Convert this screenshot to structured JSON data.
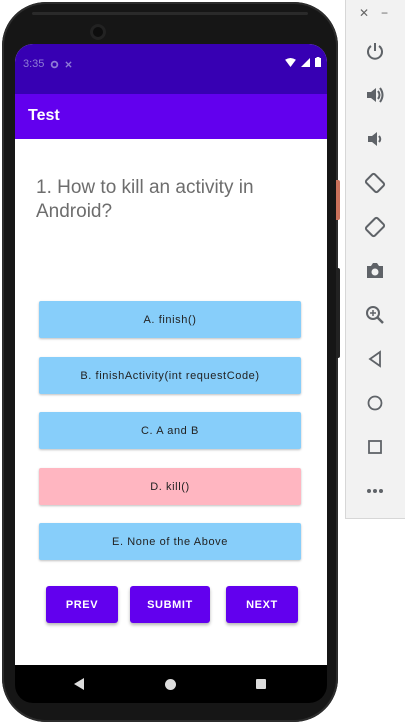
{
  "status_bar": {
    "time": "3:35"
  },
  "app_bar": {
    "title": "Test"
  },
  "question": {
    "text": "1. How to kill an activity in Android?"
  },
  "options": [
    {
      "label": "A. finish()",
      "state": "default"
    },
    {
      "label": "B. finishActivity(int requestCode)",
      "state": "default"
    },
    {
      "label": "C. A and B",
      "state": "default"
    },
    {
      "label": "D. kill()",
      "state": "selected-wrong"
    },
    {
      "label": "E. None of the Above",
      "state": "default"
    }
  ],
  "navigation": {
    "prev_label": "PREV",
    "submit_label": "SUBMIT",
    "next_label": "NEXT"
  },
  "colors": {
    "status_bar": "#3700b3",
    "app_bar": "#6200ee",
    "option_default": "#87cefa",
    "option_wrong": "#ffb6c1",
    "nav_button": "#6200ee"
  },
  "emulator_toolbar": {
    "tools": [
      "power-icon",
      "volume-up-icon",
      "volume-down-icon",
      "rotate-left-icon",
      "rotate-right-icon",
      "camera-icon",
      "zoom-icon",
      "back-icon",
      "home-icon",
      "overview-icon",
      "more-icon"
    ]
  }
}
